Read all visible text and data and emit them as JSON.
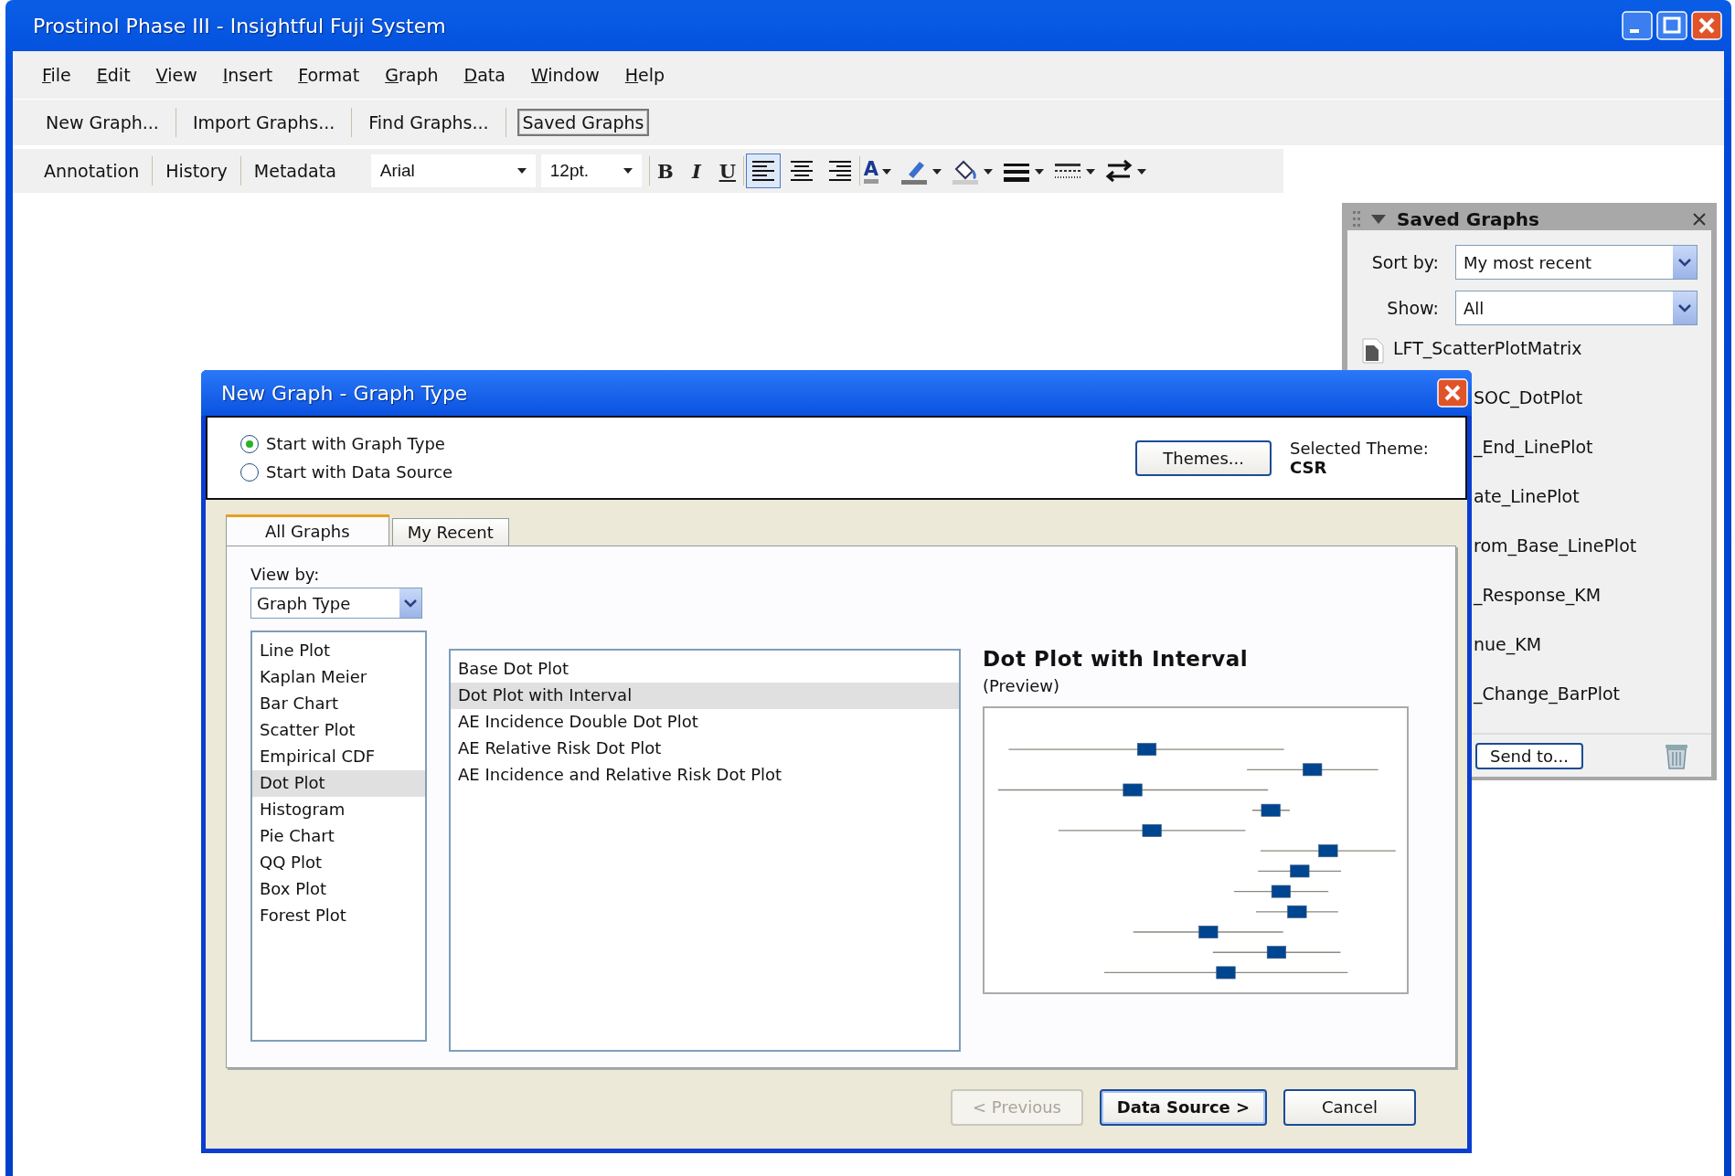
{
  "window": {
    "title": "Prostinol Phase III - Insightful Fuji System"
  },
  "menu": [
    "File",
    "Edit",
    "View",
    "Insert",
    "Format",
    "Graph",
    "Data",
    "Window",
    "Help"
  ],
  "toolbar": [
    {
      "label": "New Graph...",
      "selected": false
    },
    {
      "label": "Import Graphs...",
      "selected": false
    },
    {
      "label": "Find Graphs...",
      "selected": false
    },
    {
      "label": "Saved Graphs",
      "selected": true
    }
  ],
  "format_bar": {
    "tabs": [
      "Annotation",
      "History",
      "Metadata"
    ],
    "font": "Arial",
    "size": "12pt.",
    "style_buttons": [
      "B",
      "I",
      "U"
    ],
    "font_color_glyph": "A",
    "align": [
      {
        "kind": "left",
        "selected": true
      },
      {
        "kind": "center",
        "selected": false
      },
      {
        "kind": "right",
        "selected": false
      }
    ]
  },
  "saved_panel": {
    "title": "Saved Graphs",
    "sort_label": "Sort by:",
    "sort_value": "My most recent",
    "show_label": "Show:",
    "show_value": "All",
    "items": [
      "LFT_ScatterPlotMatrix",
      "SOC_DotPlot",
      "_End_LinePlot",
      "ate_LinePlot",
      "rom_Base_LinePlot",
      "_Response_KM",
      "nue_KM",
      "_Change_BarPlot"
    ],
    "send_button": "Send to..."
  },
  "dialog": {
    "title": "New Graph - Graph Type",
    "start_options": [
      {
        "label": "Start with Graph Type",
        "selected": true
      },
      {
        "label": "Start with Data Source",
        "selected": false
      }
    ],
    "themes_button": "Themes...",
    "theme_label": "Selected Theme:",
    "theme_value": "CSR",
    "tabs": [
      {
        "label": "All Graphs",
        "selected": true
      },
      {
        "label": "My Recent",
        "selected": false
      }
    ],
    "view_by_label": "View by:",
    "view_by_value": "Graph Type",
    "categories": [
      {
        "label": "Line Plot",
        "selected": false
      },
      {
        "label": "Kaplan Meier",
        "selected": false
      },
      {
        "label": "Bar Chart",
        "selected": false
      },
      {
        "label": "Scatter Plot",
        "selected": false
      },
      {
        "label": "Empirical CDF",
        "selected": false
      },
      {
        "label": "Dot Plot",
        "selected": true
      },
      {
        "label": "Histogram",
        "selected": false
      },
      {
        "label": "Pie Chart",
        "selected": false
      },
      {
        "label": "QQ Plot",
        "selected": false
      },
      {
        "label": "Box Plot",
        "selected": false
      },
      {
        "label": "Forest Plot",
        "selected": false
      }
    ],
    "graph_types": [
      {
        "label": "Base Dot Plot",
        "selected": false
      },
      {
        "label": "Dot Plot with Interval",
        "selected": true
      },
      {
        "label": "AE Incidence Double Dot Plot",
        "selected": false
      },
      {
        "label": "AE Relative Risk Dot Plot",
        "selected": false
      },
      {
        "label": "AE Incidence and Relative Risk Dot Plot",
        "selected": false
      }
    ],
    "preview_title": "Dot Plot with Interval",
    "preview_subtitle": "(Preview)",
    "buttons": [
      {
        "label": "< Previous",
        "disabled": true,
        "default": false
      },
      {
        "label": "Data Source >",
        "disabled": false,
        "default": true
      },
      {
        "label": "Cancel",
        "disabled": false,
        "default": false
      }
    ]
  }
}
